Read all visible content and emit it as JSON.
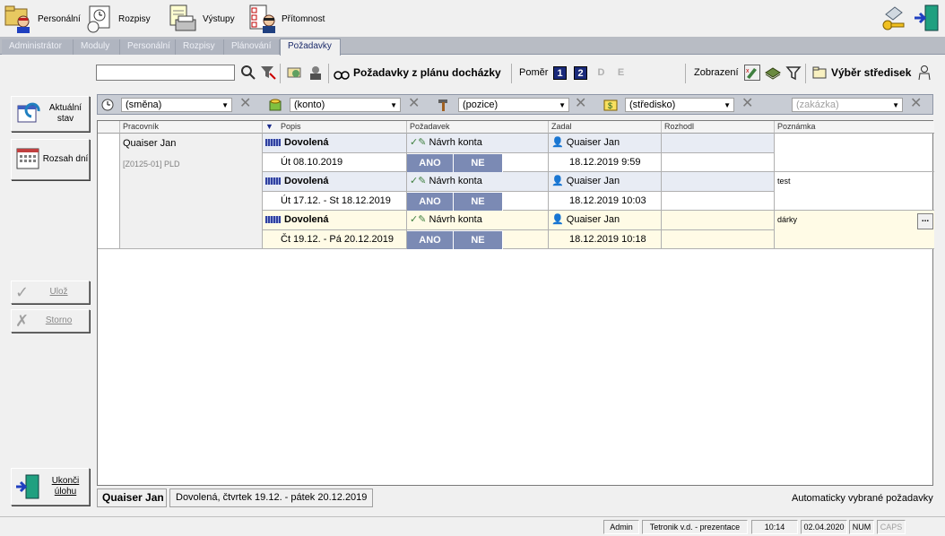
{
  "toolbar": {
    "personalni": "Personální",
    "rozpisy": "Rozpisy",
    "vystupy": "Výstupy",
    "pritomnost": "Přítomnost"
  },
  "tabs": [
    "Administrátor",
    "Moduly",
    "Personální",
    "Rozpisy",
    "Plánování",
    "Požadavky"
  ],
  "toolbar2": {
    "search_value": "",
    "pozadavky_label": "Požadavky z plánu docházky",
    "pomer_label": "Poměr",
    "num1": "1",
    "num2": "2",
    "letter_d": "D",
    "letter_e": "E",
    "zobrazeni_label": "Zobrazení",
    "vyber_label": "Výběr středisek"
  },
  "side": {
    "aktualni": "Aktuální stav",
    "rozsah": "Rozsah dní",
    "uloz": "Ulož",
    "storno": "Storno",
    "ukonci": "Ukonči úlohu"
  },
  "filters": {
    "smena": "(směna)",
    "konto": "(konto)",
    "pozice": "(pozice)",
    "stredisko": "(středisko)",
    "zakazka": "(zakázka)"
  },
  "grid": {
    "headers": [
      "Pracovník",
      "Popis",
      "Požadavek",
      "Zadal",
      "Rozhodl",
      "Poznámka"
    ],
    "employee_name": "Quaiser Jan",
    "employee_code": "[Z0125-01] PLD",
    "ano": "ANO",
    "ne": "NE",
    "rows": [
      {
        "type": "Dovolená",
        "dates": "Út 08.10.2019",
        "request": "Návrh konta",
        "by": "Quaiser Jan",
        "when": "18.12.2019 9:59",
        "note": ""
      },
      {
        "type": "Dovolená",
        "dates": "Út 17.12. - St 18.12.2019",
        "request": "Návrh konta",
        "by": "Quaiser Jan",
        "when": "18.12.2019 10:03",
        "note": "test"
      },
      {
        "type": "Dovolená",
        "dates": "Čt 19.12. - Pá 20.12.2019",
        "request": "Návrh konta",
        "by": "Quaiser Jan",
        "when": "18.12.2019 10:18",
        "note": "dárky"
      }
    ],
    "ellipsis": "..."
  },
  "status_panel": {
    "name": "Quaiser Jan",
    "detail": "Dovolená, čtvrtek 19.12. - pátek 20.12.2019",
    "auto": "Automaticky vybrané požadavky"
  },
  "statusbar": {
    "user": "Admin",
    "company": "Tetronik v.d. - prezentace",
    "time": "10:14",
    "date": "02.04.2020",
    "num": "NUM",
    "caps": "CAPS"
  },
  "colors": {
    "selected_row": "#fffbe6",
    "row_header": "#e8ecf4",
    "ano_ne": "#7b8ab4",
    "tab_active": "#1a2a6a"
  }
}
